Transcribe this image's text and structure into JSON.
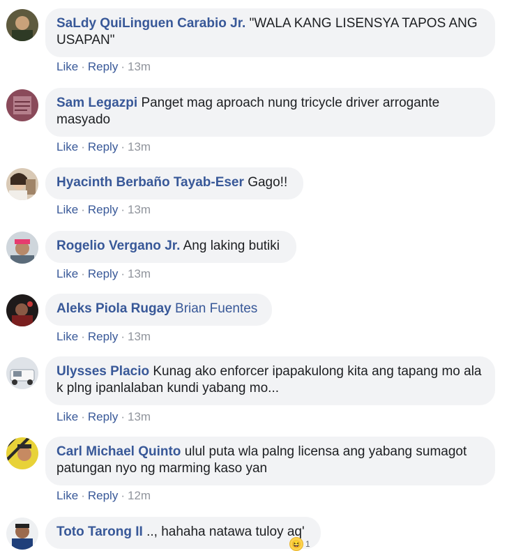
{
  "comments": [
    {
      "author": "SaLdy QuiLinguen Carabio Jr.",
      "text": "\"WALA KANG LISENSYA TAPOS ANG USAPAN\"",
      "like": "Like",
      "reply": "Reply",
      "time": "13m"
    },
    {
      "author": "Sam Legazpi",
      "text": "Panget mag aproach nung tricycle driver arrogante masyado",
      "like": "Like",
      "reply": "Reply",
      "time": "13m"
    },
    {
      "author": "Hyacinth Berbaño Tayab-Eser",
      "text": "Gago!!",
      "like": "Like",
      "reply": "Reply",
      "time": "13m"
    },
    {
      "author": "Rogelio Vergano Jr.",
      "text": "Ang laking butiki",
      "like": "Like",
      "reply": "Reply",
      "time": "13m"
    },
    {
      "author": "Aleks Piola Rugay",
      "tagged": "Brian Fuentes",
      "like": "Like",
      "reply": "Reply",
      "time": "13m"
    },
    {
      "author": "Ulysses Placio",
      "text": "Kunag ako enforcer ipapakulong kita ang tapang mo ala k plng ipanlalaban kundi yabang mo...",
      "like": "Like",
      "reply": "Reply",
      "time": "13m"
    },
    {
      "author": "Carl Michael Quinto",
      "text": "ulul puta wla palng licensa ang yabang sumagot patungan nyo ng marming kaso yan",
      "like": "Like",
      "reply": "Reply",
      "time": "12m"
    },
    {
      "author": "Toto Tarong II",
      "text": ".., hahaha natawa tuloy aq'",
      "reaction_count": "1"
    }
  ],
  "reaction_icon": "haha-emoji-icon",
  "colors": {
    "author": "#385898",
    "bubble": "#f2f3f5",
    "text": "#1c1e21",
    "meta": "#90949c"
  }
}
